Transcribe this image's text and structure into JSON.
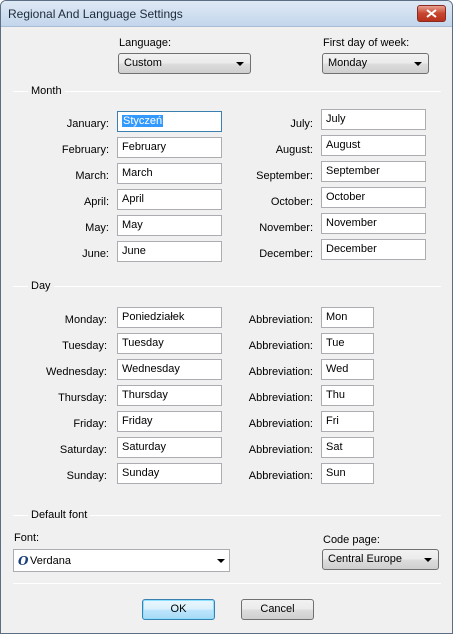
{
  "window": {
    "title": "Regional And Language Settings"
  },
  "language": {
    "label": "Language:",
    "value": "Custom"
  },
  "first_day": {
    "label": "First day of week:",
    "value": "Monday"
  },
  "month_group": {
    "title": "Month",
    "left": [
      {
        "label": "January:",
        "value": "Styczeń"
      },
      {
        "label": "February:",
        "value": "February"
      },
      {
        "label": "March:",
        "value": "March"
      },
      {
        "label": "April:",
        "value": "April"
      },
      {
        "label": "May:",
        "value": "May"
      },
      {
        "label": "June:",
        "value": "June"
      }
    ],
    "right": [
      {
        "label": "July:",
        "value": "July"
      },
      {
        "label": "August:",
        "value": "August"
      },
      {
        "label": "September:",
        "value": "September"
      },
      {
        "label": "October:",
        "value": "October"
      },
      {
        "label": "November:",
        "value": "November"
      },
      {
        "label": "December:",
        "value": "December"
      }
    ]
  },
  "day_group": {
    "title": "Day",
    "abbr_label": "Abbreviation:",
    "rows": [
      {
        "label": "Monday:",
        "value": "Poniedziałek",
        "abbr": "Mon"
      },
      {
        "label": "Tuesday:",
        "value": "Tuesday",
        "abbr": "Tue"
      },
      {
        "label": "Wednesday:",
        "value": "Wednesday",
        "abbr": "Wed"
      },
      {
        "label": "Thursday:",
        "value": "Thursday",
        "abbr": "Thu"
      },
      {
        "label": "Friday:",
        "value": "Friday",
        "abbr": "Fri"
      },
      {
        "label": "Saturday:",
        "value": "Saturday",
        "abbr": "Sat"
      },
      {
        "label": "Sunday:",
        "value": "Sunday",
        "abbr": "Sun"
      }
    ]
  },
  "font_group": {
    "title": "Default font",
    "font_label": "Font:",
    "font_value": "Verdana",
    "codepage_label": "Code page:",
    "codepage_value": "Central Europe"
  },
  "buttons": {
    "ok": "OK",
    "cancel": "Cancel"
  }
}
